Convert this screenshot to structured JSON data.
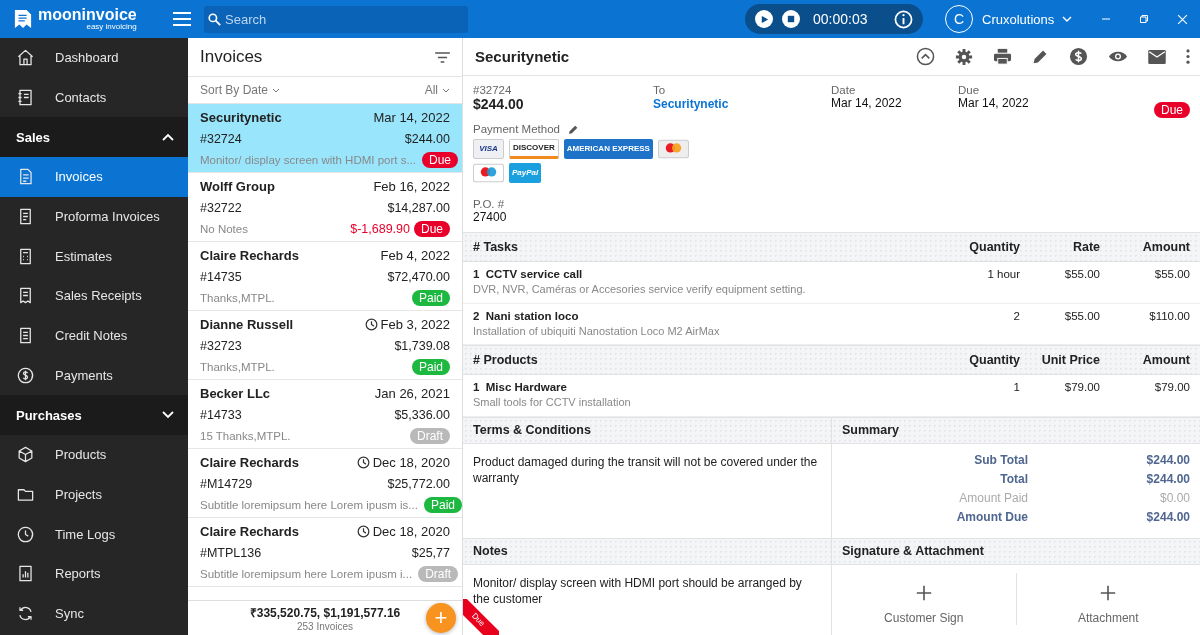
{
  "app": {
    "logo_title": "mooninvoice",
    "logo_subtitle": "easy invoicing",
    "search": {
      "placeholder": "Search"
    },
    "timer": {
      "time": "00:00:03"
    },
    "user": {
      "initial": "C",
      "name": "Cruxolutions"
    }
  },
  "sidebar": {
    "items": [
      {
        "kind": "item",
        "label": "Dashboard",
        "selected": false
      },
      {
        "kind": "item",
        "label": "Contacts",
        "selected": false
      },
      {
        "kind": "section",
        "label": "Sales",
        "expanded": true
      },
      {
        "kind": "item",
        "label": "Invoices",
        "selected": true
      },
      {
        "kind": "item",
        "label": "Proforma Invoices",
        "selected": false
      },
      {
        "kind": "item",
        "label": "Estimates",
        "selected": false
      },
      {
        "kind": "item",
        "label": "Sales Receipts",
        "selected": false
      },
      {
        "kind": "item",
        "label": "Credit Notes",
        "selected": false
      },
      {
        "kind": "item",
        "label": "Payments",
        "selected": false
      },
      {
        "kind": "section",
        "label": "Purchases",
        "expanded": false
      },
      {
        "kind": "item",
        "label": "Products",
        "selected": false
      },
      {
        "kind": "item",
        "label": "Projects",
        "selected": false
      },
      {
        "kind": "item",
        "label": "Time Logs",
        "selected": false
      },
      {
        "kind": "item",
        "label": "Reports",
        "selected": false
      },
      {
        "kind": "item",
        "label": "Sync",
        "selected": false
      }
    ]
  },
  "invoice_list": {
    "title": "Invoices",
    "sort": "Sort By Date",
    "filter": "All",
    "items": [
      {
        "name": "Securitynetic",
        "date": "Mar 14, 2022",
        "scheduled": false,
        "number": "#32724",
        "amount": "$244.00",
        "note": "Monitor/ display screen with HDMI port s...",
        "status": {
          "label": "Due",
          "kind": "due"
        },
        "selected": true
      },
      {
        "name": "Wolff Group",
        "date": "Feb 16, 2022",
        "scheduled": false,
        "number": "#32722",
        "amount": "$14,287.00",
        "note": "No Notes",
        "balance": "$-1,689.90",
        "status": {
          "label": "Due",
          "kind": "due"
        },
        "selected": false
      },
      {
        "name": "Claire Rechards",
        "date": "Feb 4, 2022",
        "scheduled": false,
        "number": "#14735",
        "amount": "$72,470.00",
        "note": "Thanks,MTPL.",
        "status": {
          "label": "Paid",
          "kind": "paid"
        },
        "selected": false
      },
      {
        "name": "Dianne Russell",
        "date": "Feb 3, 2022",
        "scheduled": true,
        "number": "#32723",
        "amount": "$1,739.08",
        "note": "Thanks,MTPL.",
        "status": {
          "label": "Paid",
          "kind": "paid"
        },
        "selected": false
      },
      {
        "name": "Becker LLc",
        "date": "Jan 26, 2021",
        "scheduled": false,
        "number": "#14733",
        "amount": "$5,336.00",
        "note": "15 Thanks,MTPL.",
        "status": {
          "label": "Draft",
          "kind": "draft"
        },
        "selected": false
      },
      {
        "name": "Claire Rechards",
        "date": "Dec 18, 2020",
        "scheduled": true,
        "number": "#M14729",
        "amount": "$25,772.00",
        "note": "Subtitle loremipsum here Lorem ipusm is...",
        "status": {
          "label": "Paid",
          "kind": "paid"
        },
        "selected": false
      },
      {
        "name": "Claire Rechards",
        "date": "Dec 18, 2020",
        "scheduled": true,
        "number": "#MTPL136",
        "amount": "$25,77",
        "note": "Subtitle loremipsum here Lorem ipusm i...",
        "status": {
          "label": "Draft",
          "kind": "draft"
        },
        "selected": false
      }
    ],
    "add_button": "+",
    "footer": {
      "totals": "₹335,520.75, $1,191,577.16",
      "count": "253 Invoices"
    }
  },
  "detail": {
    "title": "Securitynetic",
    "number": "#32724",
    "total": "$244.00",
    "to_label": "To",
    "to": "Securitynetic",
    "date_label": "Date",
    "date": "Mar 14, 2022",
    "due_label": "Due",
    "due": "Mar 14, 2022",
    "status": {
      "label": "Due",
      "kind": "due"
    },
    "payment_label": "Payment Method",
    "cards": [
      {
        "kind": "visa",
        "label": "VISA"
      },
      {
        "kind": "discover",
        "label": "DISCOVER"
      },
      {
        "kind": "amex",
        "label": "AMERICAN EXPRESS"
      },
      {
        "kind": "mastercard"
      },
      {
        "kind": "maestro"
      },
      {
        "kind": "paypal",
        "label": "PayPal"
      }
    ],
    "po_label": "P.O. #",
    "po": "27400",
    "tasks": {
      "columns": [
        "# Tasks",
        "Quantity",
        "Rate",
        "Amount"
      ],
      "rows": [
        {
          "index": "1",
          "name": "CCTV service call",
          "description": "DVR, NVR, Caméras or Accesories service verify equipment setting.",
          "quantity": "1 hour",
          "rate": "$55.00",
          "amount": "$55.00"
        },
        {
          "index": "2",
          "name": "Nani station loco",
          "description": "Installation of ubiquiti Nanostation Loco M2 AirMax",
          "quantity": "2",
          "rate": "$55.00",
          "amount": "$110.00"
        }
      ]
    },
    "products": {
      "columns": [
        "# Products",
        "Quantity",
        "Unit Price",
        "Amount"
      ],
      "rows": [
        {
          "index": "1",
          "name": "Misc Hardware",
          "description": "Small tools for CCTV installation",
          "quantity": "1",
          "rate": "$79.00",
          "amount": "$79.00"
        }
      ]
    },
    "terms_title": "Terms & Conditions",
    "terms": "Product damaged during the transit will not be covered under the warranty",
    "summary_title": "Summary",
    "summary": [
      {
        "label": "Sub Total",
        "value": "$244.00",
        "kind": "strong"
      },
      {
        "label": "Total",
        "value": "$244.00",
        "kind": "strong"
      },
      {
        "label": "Amount Paid",
        "value": "$0.00",
        "kind": "muted"
      },
      {
        "label": "Amount Due",
        "value": "$244.00",
        "kind": "strong"
      }
    ],
    "notes_title": "Notes",
    "notes": "Monitor/ display screen with HDMI port should be arranged by the customer",
    "signature_title": "Signature & Attachment",
    "signature_slots": [
      "Customer Sign",
      "Attachment"
    ],
    "ribbon": {
      "label": "Due",
      "kind": "due"
    }
  }
}
